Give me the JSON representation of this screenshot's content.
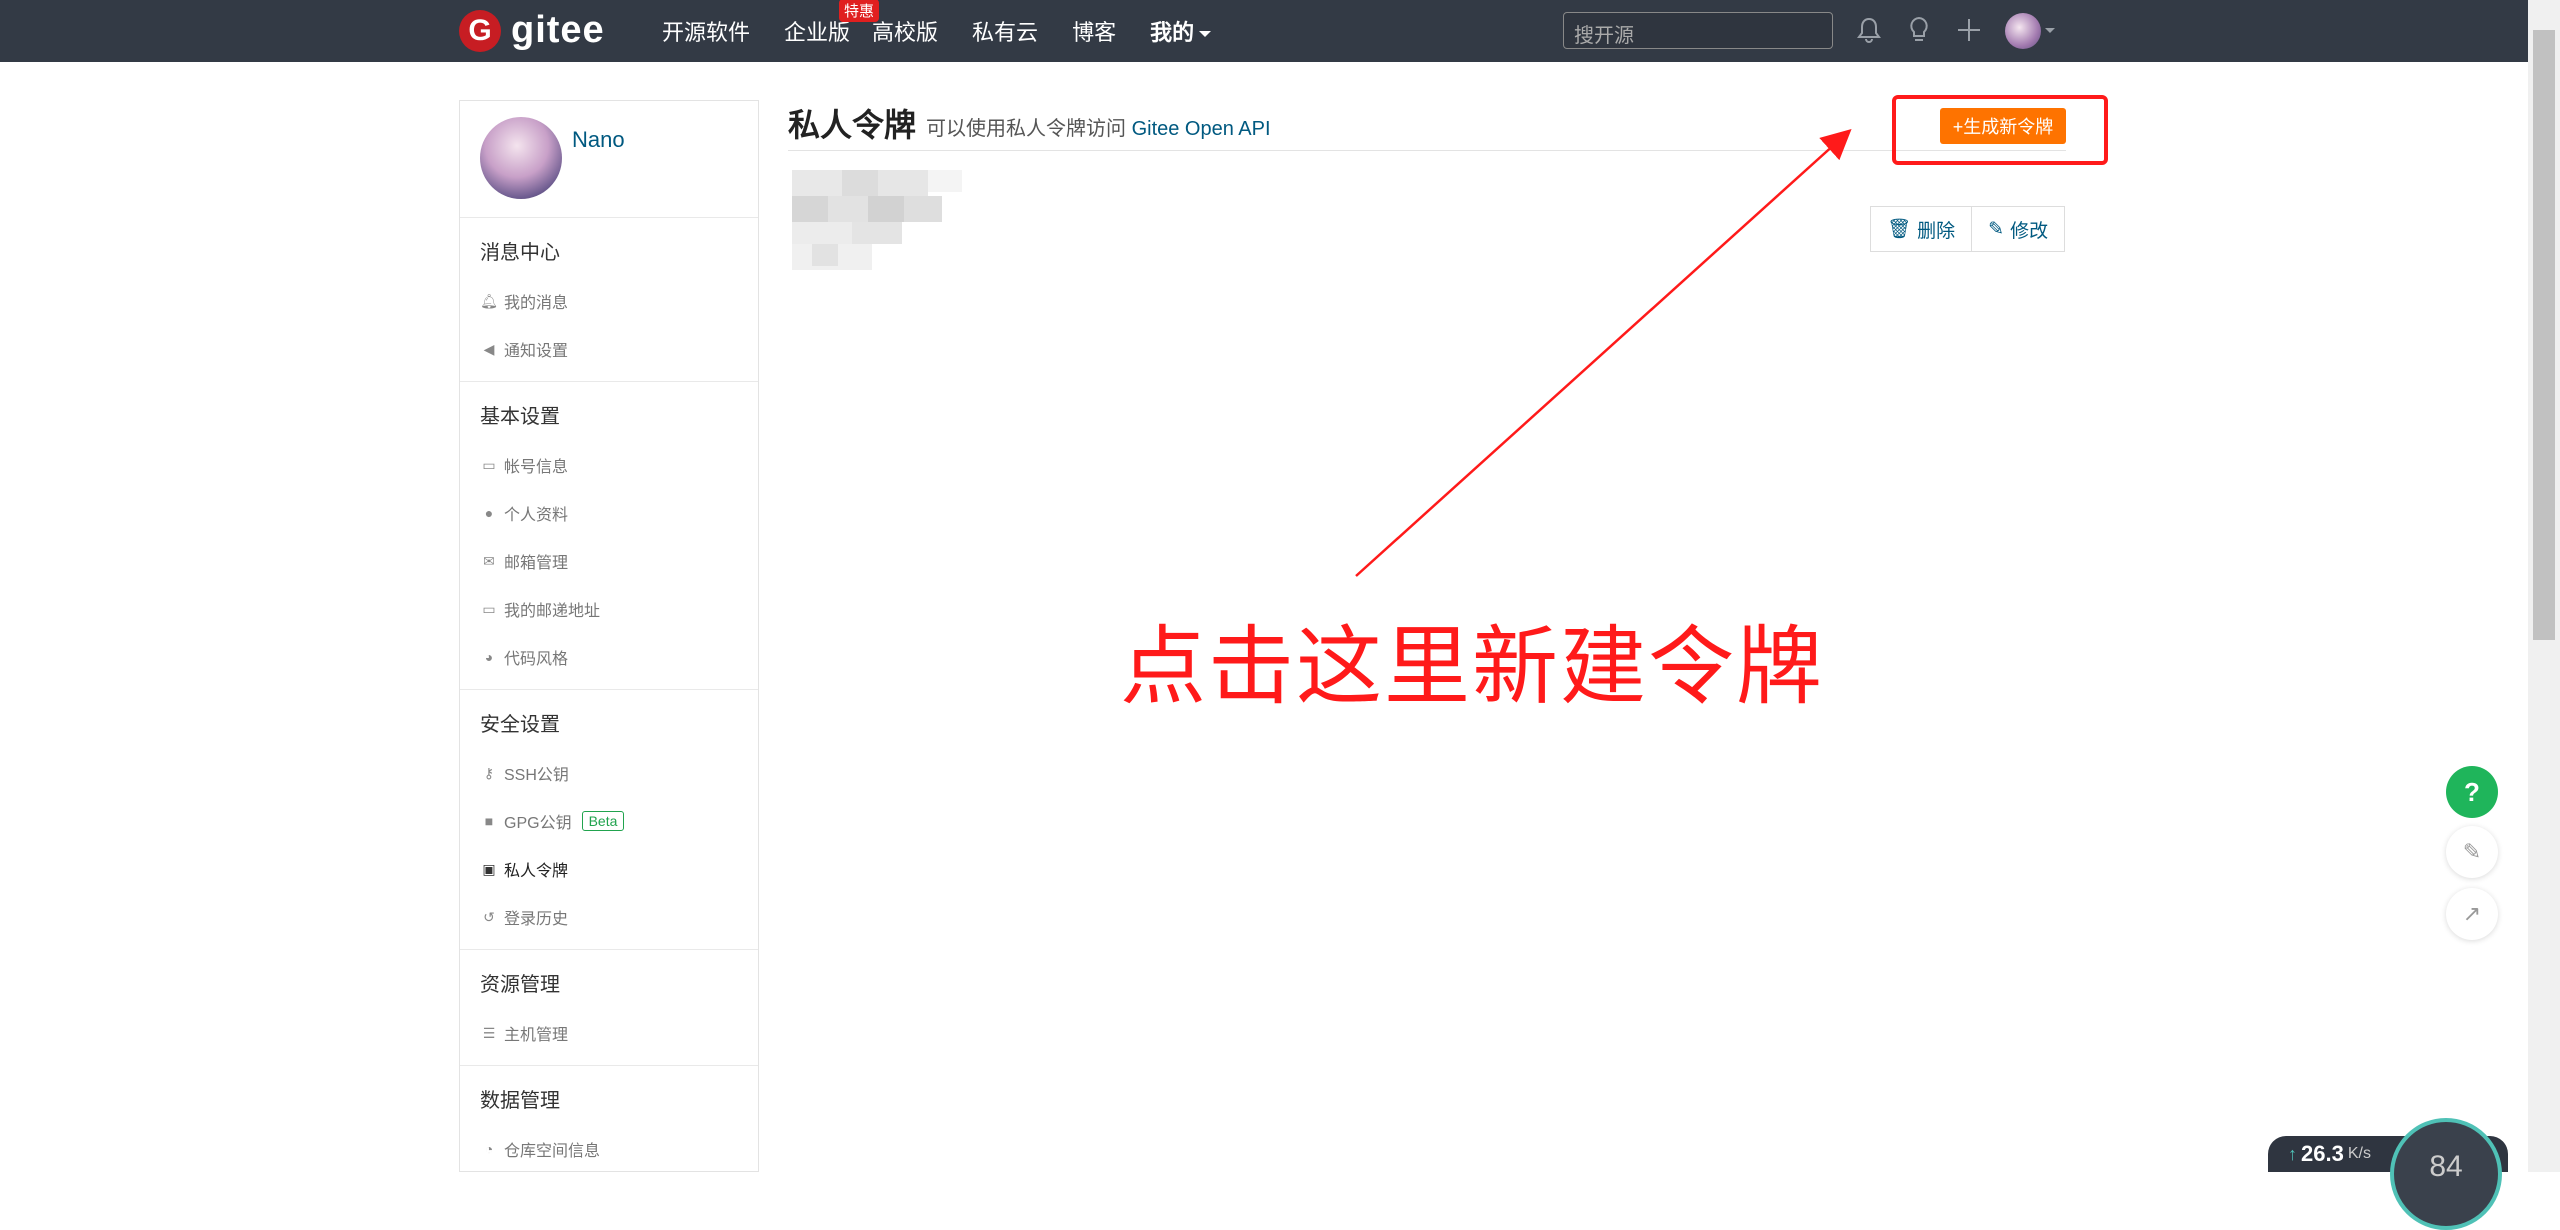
{
  "nav": {
    "logo_letter": "G",
    "logo_text": "gitee",
    "links": [
      {
        "label": "开源软件"
      },
      {
        "label": "企业版",
        "badge": "特惠"
      },
      {
        "label": "高校版"
      },
      {
        "label": "私有云"
      },
      {
        "label": "博客"
      },
      {
        "label": "我的"
      }
    ],
    "search_placeholder": "搜开源",
    "icons": [
      "bell-icon",
      "lightbulb-icon",
      "plus-icon"
    ]
  },
  "sidebar": {
    "username": "Nano",
    "sections": [
      {
        "title": "消息中心",
        "items": [
          {
            "icon": "bell-icon",
            "label": "我的消息"
          },
          {
            "icon": "speaker-icon",
            "label": "通知设置"
          }
        ]
      },
      {
        "title": "基本设置",
        "items": [
          {
            "icon": "id-card-icon",
            "label": "帐号信息"
          },
          {
            "icon": "user-icon",
            "label": "个人资料"
          },
          {
            "icon": "mail-icon",
            "label": "邮箱管理"
          },
          {
            "icon": "id-card-icon",
            "label": "我的邮递地址"
          },
          {
            "icon": "palette-icon",
            "label": "代码风格"
          }
        ]
      },
      {
        "title": "安全设置",
        "items": [
          {
            "icon": "key-icon",
            "label": "SSH公钥"
          },
          {
            "icon": "lock-icon",
            "label": "GPG公钥",
            "badge": "Beta"
          },
          {
            "icon": "token-icon",
            "label": "私人令牌",
            "active": true
          },
          {
            "icon": "history-icon",
            "label": "登录历史"
          }
        ]
      },
      {
        "title": "资源管理",
        "items": [
          {
            "icon": "server-icon",
            "label": "主机管理"
          }
        ]
      },
      {
        "title": "数据管理",
        "items": [
          {
            "icon": "pie-icon",
            "label": "仓库空间信息"
          }
        ]
      }
    ]
  },
  "main": {
    "title": "私人令牌",
    "subtitle_prefix": "可以使用私人令牌访问",
    "subtitle_link": "Gitee Open API",
    "generate_button": "+生成新令牌",
    "delete_button": "删除",
    "edit_button": "修改"
  },
  "annotation": {
    "text": "点击这里新建令牌",
    "color": "#ff1a1a"
  },
  "floating": {
    "help": "?",
    "speed_value": "26.3",
    "speed_unit": "K/s",
    "gauge_value": "84"
  },
  "colors": {
    "nav_bg": "#333a45",
    "accent_orange": "#fe7300",
    "link_blue": "#005980",
    "help_green": "#1fb55b"
  }
}
